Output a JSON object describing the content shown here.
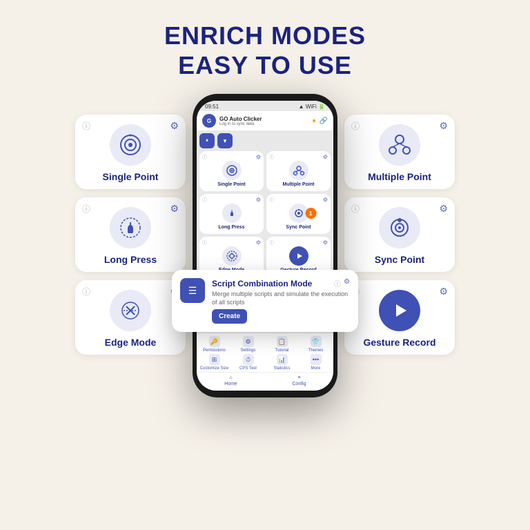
{
  "page": {
    "title_line1": "ENRICH MODES",
    "title_line2": "EASY TO USE",
    "background_color": "#f5f0e8"
  },
  "left_cards": [
    {
      "id": "single-point",
      "label": "Single Point",
      "icon": "target-icon"
    },
    {
      "id": "long-press",
      "label": "Long Press",
      "icon": "press-icon"
    },
    {
      "id": "edge-mode",
      "label": "Edge Mode",
      "icon": "edge-icon"
    }
  ],
  "right_cards": [
    {
      "id": "multiple-point",
      "label": "Multiple Point",
      "icon": "multiple-icon"
    },
    {
      "id": "sync-point",
      "label": "Sync Point",
      "icon": "sync-icon"
    },
    {
      "id": "gesture-record",
      "label": "Gesture Record",
      "icon": "gesture-icon"
    }
  ],
  "phone": {
    "time": "09:51",
    "app_name": "GO Auto Clicker",
    "app_subtitle": "Log in to sync data",
    "modes": [
      {
        "label": "Single Point"
      },
      {
        "label": "Multiple Point"
      },
      {
        "label": "Long Press"
      },
      {
        "label": "Sync Point"
      },
      {
        "label": "Edge Mode"
      },
      {
        "label": "Gesture Record"
      }
    ],
    "badge_number": "1",
    "menu_items": [
      {
        "label": "Permissions",
        "icon": "🔑"
      },
      {
        "label": "Settings",
        "icon": "⚙️"
      },
      {
        "label": "Tutorial",
        "icon": "📋"
      },
      {
        "label": "Themes",
        "icon": "👕"
      },
      {
        "label": "Customize Size",
        "icon": "⊞"
      },
      {
        "label": "CPS Test",
        "icon": "⏱"
      },
      {
        "label": "Statistics",
        "icon": "📊"
      },
      {
        "label": "More",
        "icon": "⋯"
      }
    ],
    "tabs": [
      {
        "label": "Home",
        "active": true
      },
      {
        "label": "Config",
        "active": false
      }
    ]
  },
  "script_popup": {
    "title": "Script Combination Mode",
    "description": "Merge multiple scripts and simulate the execution of all scripts",
    "create_button": "Create"
  },
  "icons": {
    "info": "ⓘ",
    "gear": "⚙",
    "pause": "⏸",
    "down": "⌄",
    "home": "⌂",
    "config": "≡"
  }
}
